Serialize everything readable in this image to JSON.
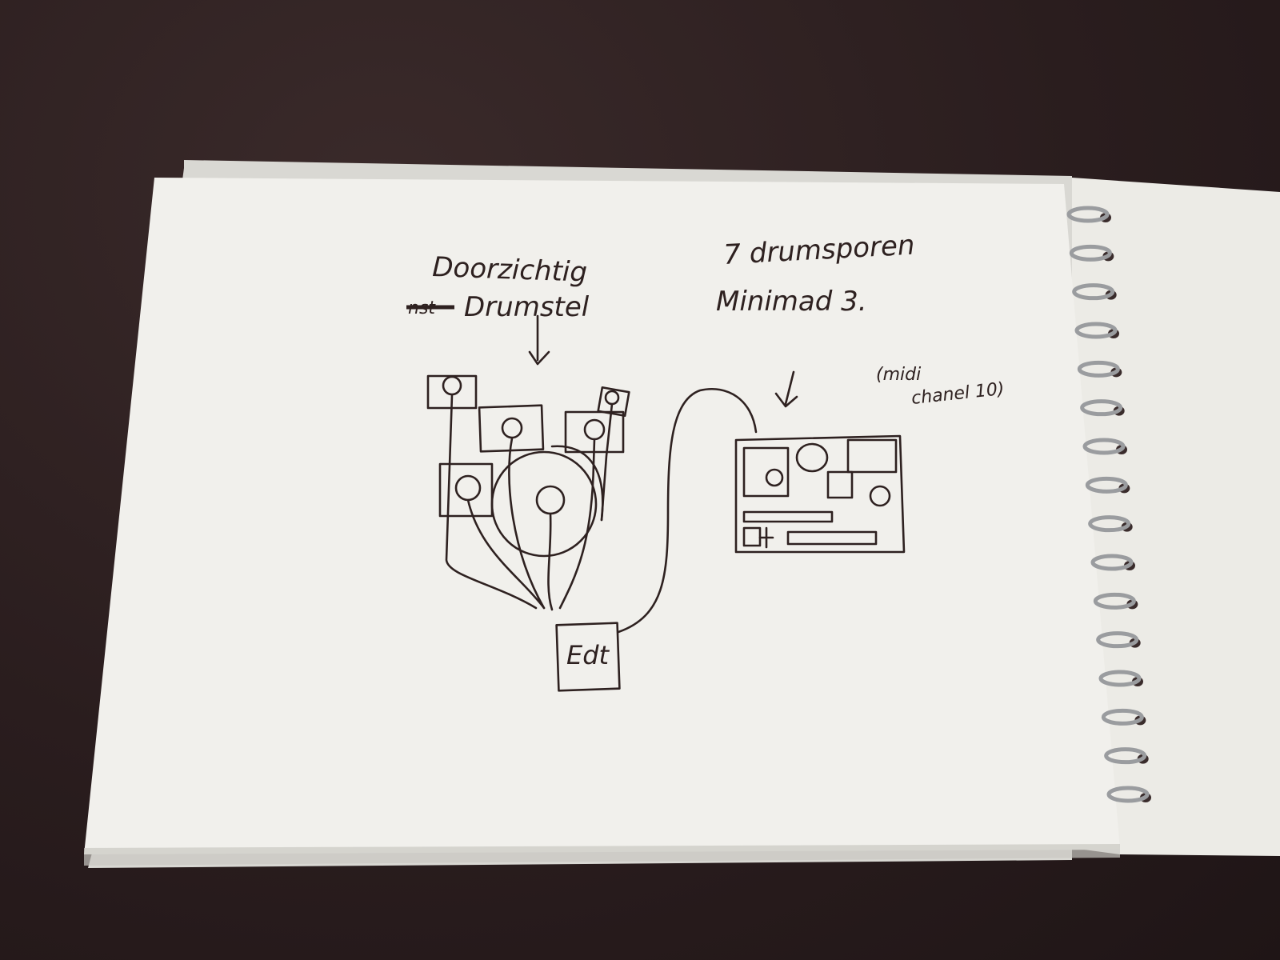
{
  "colors": {
    "background": "#2a1d1e",
    "paper": "#f1f0ec",
    "paper_shadow": "#d9d8d3",
    "ink": "#2e2120",
    "spiral": "#9a9c9f"
  },
  "sketch": {
    "label_left_line1": "Doorzichtig",
    "label_left_strike": "nst",
    "label_left_line2": "Drumstel",
    "label_right_line1": "7 drumsporen",
    "label_right_line2": "Minimad 3.",
    "label_note_line1": "(midi",
    "label_note_line2": "chanel 10)",
    "label_box": "Edt"
  },
  "spiral_icon": "spiral-binding-icon"
}
